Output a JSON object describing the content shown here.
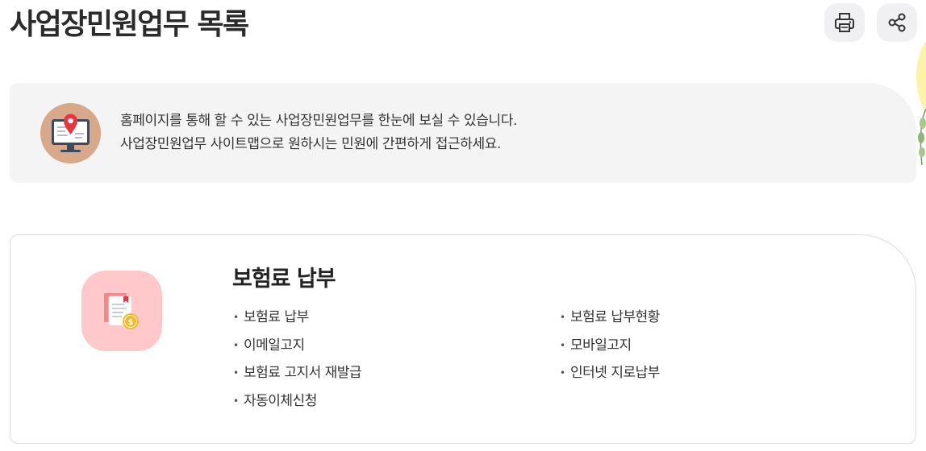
{
  "page": {
    "title": "사업장민원업무 목록"
  },
  "toolbar": {
    "print_icon": "printer-icon",
    "share_icon": "share-icon"
  },
  "info": {
    "icon": "monitor-location-pin-icon",
    "line1": "홈페이지를 통해 할 수 있는 사업장민원업무를 한눈에 보실 수 있습니다.",
    "line2": "사업장민원업무 사이트맵으로 원하시는 민원에 간편하게 접근하세요."
  },
  "section": {
    "icon": "document-coin-icon",
    "title": "보험료 납부",
    "links_left": [
      "보험료 납부",
      "이메일고지",
      "보험료 고지서 재발급",
      "자동이체신청"
    ],
    "links_right": [
      "보험료 납부현황",
      "모바일고지",
      "인터넷 지로납부"
    ]
  },
  "colors": {
    "info_bg": "#f4f4f5",
    "card_icon_bg": "#ffc9cc",
    "info_icon_bg": "#d7a98a",
    "pin_red": "#e8343c",
    "coin_yellow": "#f5b92a"
  }
}
